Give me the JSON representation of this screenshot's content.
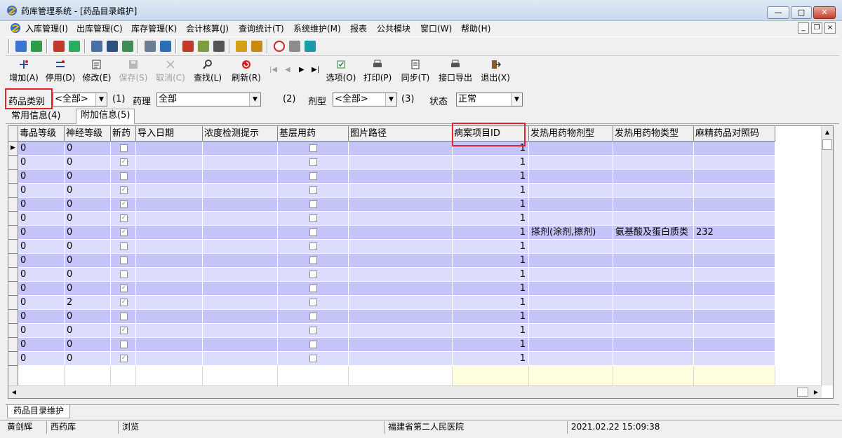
{
  "window": {
    "title": "药库管理系统 - [药品目录维护]",
    "min_label": "—",
    "max_label": "□",
    "close_label": "✕"
  },
  "menu": {
    "items": [
      "入库管理(I)",
      "出库管理(C)",
      "库存管理(K)",
      "会计核算(J)",
      "查询统计(T)",
      "系统维护(M)",
      "报表",
      "公共模块",
      "窗口(W)",
      "帮助(H)"
    ]
  },
  "toolbar": {
    "buttons": [
      {
        "label": "增加(A)",
        "icon": "add-icon",
        "enabled": true
      },
      {
        "label": "停用(D)",
        "icon": "disable-icon",
        "enabled": true
      },
      {
        "label": "修改(E)",
        "icon": "edit-icon",
        "enabled": true
      },
      {
        "label": "保存(S)",
        "icon": "save-icon",
        "enabled": false
      },
      {
        "label": "取消(C)",
        "icon": "cancel-icon",
        "enabled": false
      },
      {
        "label": "查找(L)",
        "icon": "search-icon",
        "enabled": true
      },
      {
        "label": "刷新(R)",
        "icon": "refresh-icon",
        "enabled": true
      },
      {
        "label": "选项(O)",
        "icon": "options-icon",
        "enabled": true
      },
      {
        "label": "打印(P)",
        "icon": "print-icon",
        "enabled": true
      },
      {
        "label": "同步(T)",
        "icon": "sync-icon",
        "enabled": true
      },
      {
        "label": "接口导出",
        "icon": "export-icon",
        "enabled": true
      },
      {
        "label": "退出(X)",
        "icon": "exit-icon",
        "enabled": true
      }
    ]
  },
  "filters": {
    "category_label": "药品类别",
    "category_value": "<全部>",
    "category_key": "(1)",
    "pharmacology_label": "药理",
    "pharmacology_value": "全部",
    "pharmacology_key": "(2)",
    "dosage_label": "剂型",
    "dosage_value": "<全部>",
    "dosage_key": "(3)",
    "status_label": "状态",
    "status_value": "正常"
  },
  "tabs": [
    "常用信息(4)",
    "附加信息(5)"
  ],
  "grid": {
    "columns": [
      "毒品等级",
      "神经等级",
      "新药",
      "导入日期",
      "浓度检测提示",
      "基层用药",
      "图片路径",
      "病案项目ID",
      "发热用药物剂型",
      "发热用药物类型",
      "麻精药品对照码"
    ],
    "rows": [
      {
        "c0": "0",
        "c1": "0",
        "newdrug": false,
        "caseid": "1",
        "ft": "",
        "fk": "",
        "mz": ""
      },
      {
        "c0": "0",
        "c1": "0",
        "newdrug": true,
        "caseid": "1",
        "ft": "",
        "fk": "",
        "mz": ""
      },
      {
        "c0": "0",
        "c1": "0",
        "newdrug": false,
        "caseid": "1",
        "ft": "",
        "fk": "",
        "mz": ""
      },
      {
        "c0": "0",
        "c1": "0",
        "newdrug": true,
        "caseid": "1",
        "ft": "",
        "fk": "",
        "mz": ""
      },
      {
        "c0": "0",
        "c1": "0",
        "newdrug": true,
        "caseid": "1",
        "ft": "",
        "fk": "",
        "mz": ""
      },
      {
        "c0": "0",
        "c1": "0",
        "newdrug": true,
        "caseid": "1",
        "ft": "",
        "fk": "",
        "mz": ""
      },
      {
        "c0": "0",
        "c1": "0",
        "newdrug": true,
        "caseid": "1",
        "ft": "搽剂(涂剂,擦剂)",
        "fk": "氨基酸及蛋白质类",
        "mz": "232"
      },
      {
        "c0": "0",
        "c1": "0",
        "newdrug": false,
        "caseid": "1",
        "ft": "",
        "fk": "",
        "mz": ""
      },
      {
        "c0": "0",
        "c1": "0",
        "newdrug": false,
        "caseid": "1",
        "ft": "",
        "fk": "",
        "mz": ""
      },
      {
        "c0": "0",
        "c1": "0",
        "newdrug": false,
        "caseid": "1",
        "ft": "",
        "fk": "",
        "mz": ""
      },
      {
        "c0": "0",
        "c1": "0",
        "newdrug": true,
        "caseid": "1",
        "ft": "",
        "fk": "",
        "mz": ""
      },
      {
        "c0": "0",
        "c1": "2",
        "newdrug": true,
        "caseid": "1",
        "ft": "",
        "fk": "",
        "mz": ""
      },
      {
        "c0": "0",
        "c1": "0",
        "newdrug": false,
        "caseid": "1",
        "ft": "",
        "fk": "",
        "mz": ""
      },
      {
        "c0": "0",
        "c1": "0",
        "newdrug": true,
        "caseid": "1",
        "ft": "",
        "fk": "",
        "mz": ""
      },
      {
        "c0": "0",
        "c1": "0",
        "newdrug": false,
        "caseid": "1",
        "ft": "",
        "fk": "",
        "mz": ""
      },
      {
        "c0": "0",
        "c1": "0",
        "newdrug": true,
        "caseid": "1",
        "ft": "",
        "fk": "",
        "mz": ""
      }
    ]
  },
  "bottom_tab": "药品目录维护",
  "status": {
    "user": "黄剑辉",
    "warehouse": "西药库",
    "mode": "浏览",
    "hospital": "福建省第二人民医院",
    "datetime": "2021.02.22 15:09:38"
  },
  "colors": {
    "row_dark": "#c4c4f8",
    "row_light": "#dcdcfc",
    "highlight": "#e3242b",
    "new_row_yellow": "#ffffe0"
  }
}
